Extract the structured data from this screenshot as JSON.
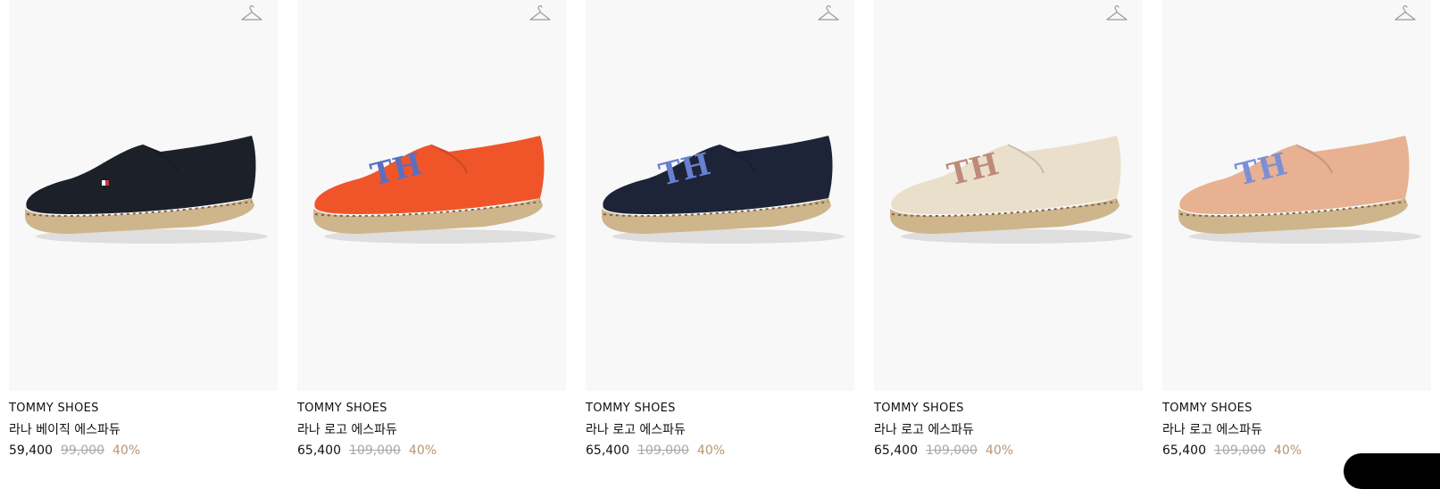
{
  "products": [
    {
      "brand": "TOMMY SHOES",
      "name": "라나 베이직 에스파듀",
      "sale_price": "59,400",
      "original_price": "99,000",
      "discount": "40%",
      "upper_color": "#1c2029",
      "logo": "flag",
      "logo_color": "#c83b3b"
    },
    {
      "brand": "TOMMY SHOES",
      "name": "라나 로고 에스파듀",
      "sale_price": "65,400",
      "original_price": "109,000",
      "discount": "40%",
      "upper_color": "#f0552a",
      "logo": "th-monogram",
      "logo_color": "#5a6fc0"
    },
    {
      "brand": "TOMMY SHOES",
      "name": "라나 로고 에스파듀",
      "sale_price": "65,400",
      "original_price": "109,000",
      "discount": "40%",
      "upper_color": "#1d2438",
      "logo": "th-monogram",
      "logo_color": "#6a7fd0"
    },
    {
      "brand": "TOMMY SHOES",
      "name": "라나 로고 에스파듀",
      "sale_price": "65,400",
      "original_price": "109,000",
      "discount": "40%",
      "upper_color": "#e9dfcb",
      "logo": "th-monogram",
      "logo_color": "#c08a7a"
    },
    {
      "brand": "TOMMY SHOES",
      "name": "라나 로고 에스파듀",
      "sale_price": "65,400",
      "original_price": "109,000",
      "discount": "40%",
      "upper_color": "#e7b192",
      "logo": "th-monogram",
      "logo_color": "#7c8fd6"
    }
  ],
  "colors": {
    "image_bg": "#f8f8f8",
    "discount": "#b89472",
    "original_price": "#a8a8a8",
    "jute": "#cfb58c"
  },
  "icons": {
    "wishlist": "hanger-icon"
  }
}
